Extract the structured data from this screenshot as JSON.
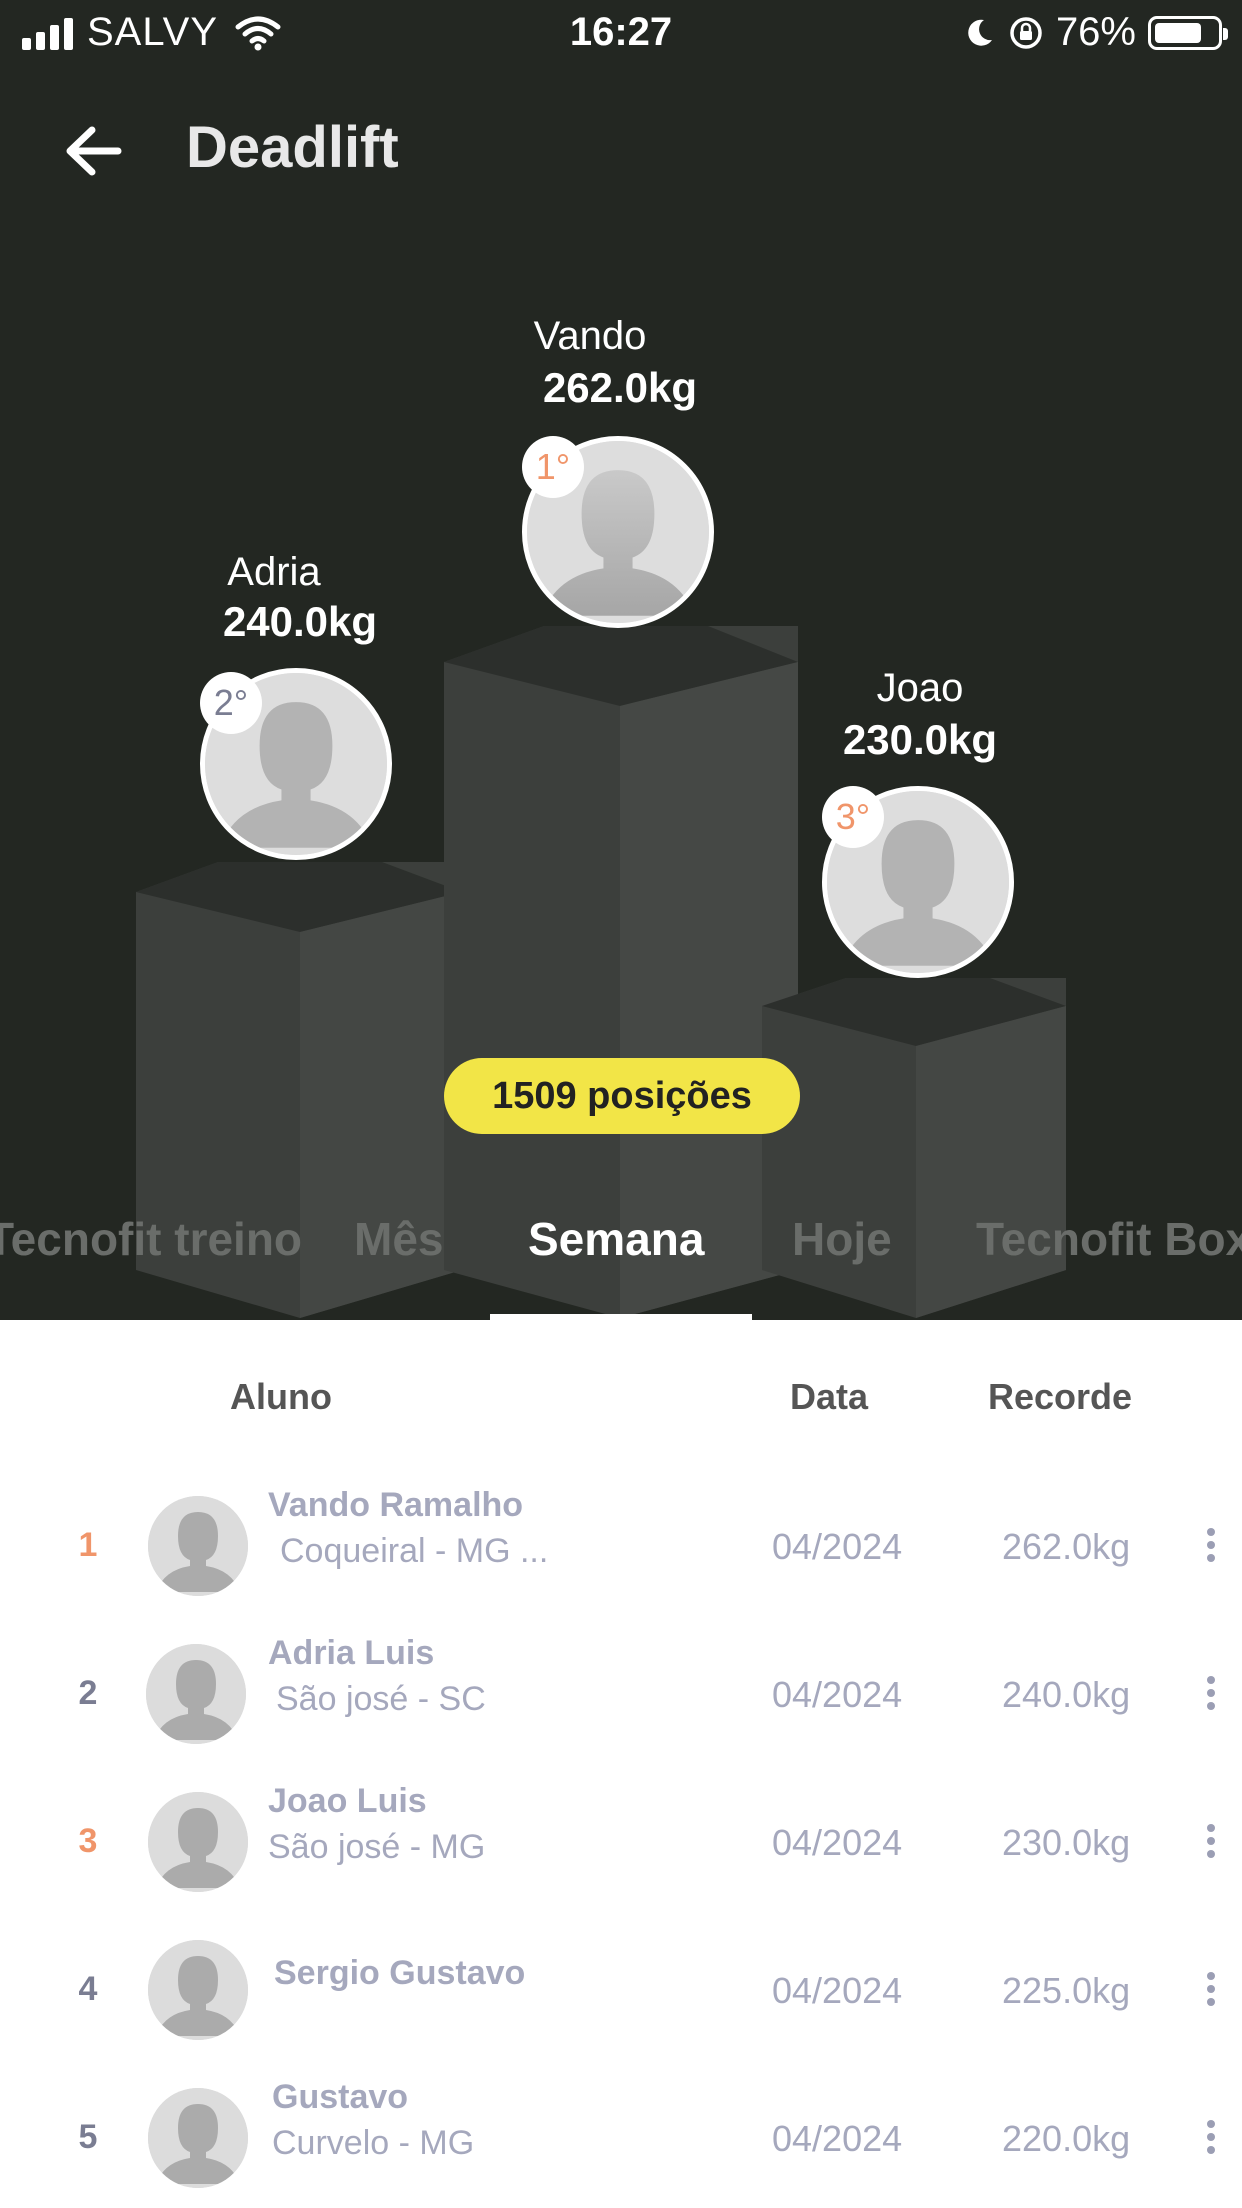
{
  "status_bar": {
    "carrier": "SALVY",
    "time": "16:27",
    "battery": "76%",
    "battery_level": 0.76
  },
  "header": {
    "back_icon": "arrow-left-icon",
    "title": "Deadlift"
  },
  "podium": {
    "first": {
      "name": "Vando",
      "kg": "262.0kg",
      "rank": "1°"
    },
    "second": {
      "name": "Adria",
      "kg": "240.0kg",
      "rank": "2°"
    },
    "third": {
      "name": "Joao",
      "kg": "230.0kg",
      "rank": "3°"
    },
    "positions": "1509 posições"
  },
  "tabs": [
    {
      "label": "Tecnofit treino"
    },
    {
      "label": "Mês"
    },
    {
      "label": "Semana"
    },
    {
      "label": "Hoje"
    },
    {
      "label": "Tecnofit Box"
    }
  ],
  "active_tab": "Semana",
  "table": {
    "headers": {
      "student": "Aluno",
      "date": "Data",
      "record": "Recorde"
    },
    "rows": [
      {
        "rank": "1",
        "name": "Vando Ramalho",
        "location": "Coqueiral - MG   ...",
        "date": "04/2024",
        "record": "262.0kg"
      },
      {
        "rank": "2",
        "name": "Adria Luis",
        "location": "São josé - SC",
        "date": "04/2024",
        "record": "240.0kg"
      },
      {
        "rank": "3",
        "name": "Joao Luis",
        "location": "São josé -  MG",
        "date": "04/2024",
        "record": "230.0kg"
      },
      {
        "rank": "4",
        "name": "Sergio Gustavo",
        "location": "",
        "date": "04/2024",
        "record": "225.0kg"
      },
      {
        "rank": "5",
        "name": "Gustavo",
        "location": "Curvelo - MG",
        "date": "04/2024",
        "record": "220.0kg"
      }
    ]
  },
  "colors": {
    "header_bg": "#232722",
    "pill": "#f2e547",
    "rank_gold": "#f0956a",
    "rank_silver": "#7a7d92",
    "rank_bronze": "#f0956a",
    "text_muted": "#a5a8bd"
  }
}
